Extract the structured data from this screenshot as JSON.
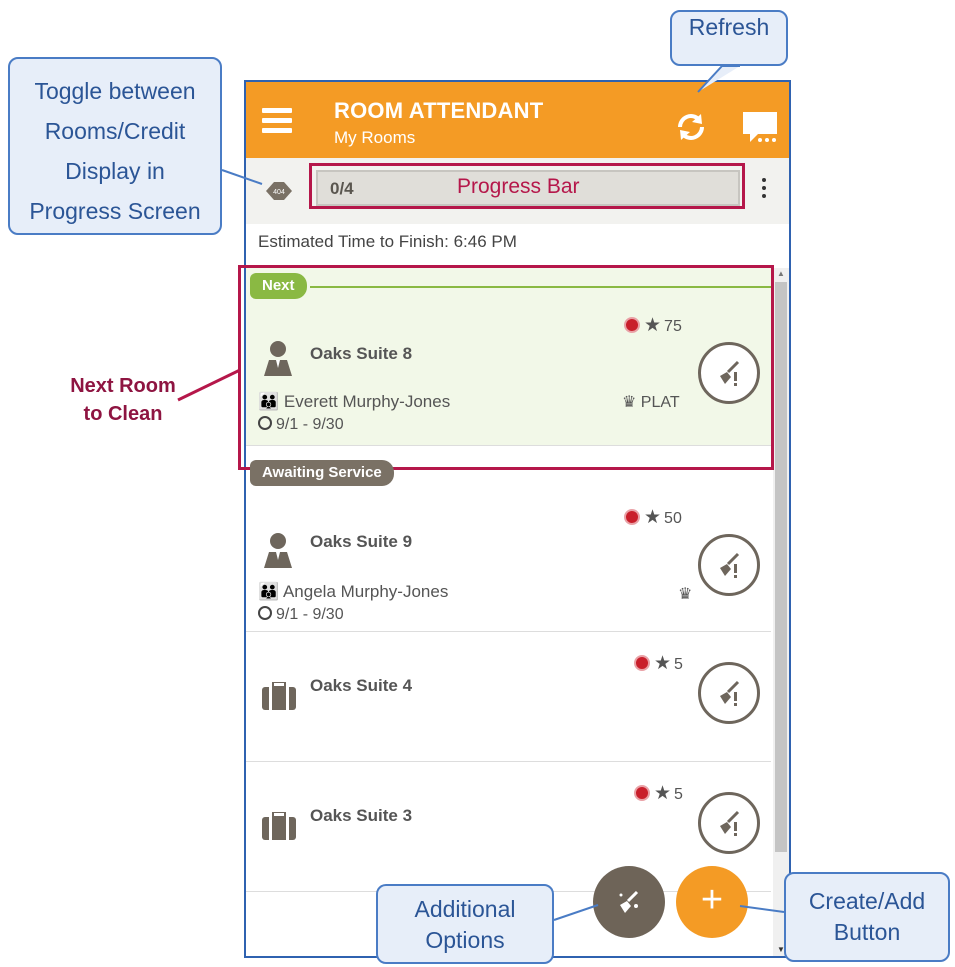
{
  "header": {
    "title": "ROOM ATTENDANT",
    "subtitle": "My Rooms"
  },
  "progress": {
    "toggle_label": "404",
    "count": "0/4",
    "bar_label": "Progress Bar"
  },
  "eta": "Estimated Time to Finish: 6:46 PM",
  "sections": {
    "next": "Next",
    "awaiting": "Awaiting Service"
  },
  "rooms": [
    {
      "name": "Oaks Suite 8",
      "guest": "Everett Murphy-Jones",
      "dates": "9/1 - 9/30",
      "points": "75",
      "vip": "PLAT",
      "type": "person-icon"
    },
    {
      "name": "Oaks Suite 9",
      "guest": "Angela Murphy-Jones",
      "dates": "9/1 - 9/30",
      "points": "50",
      "vip": "",
      "type": "person-icon"
    },
    {
      "name": "Oaks Suite 4",
      "points": "5",
      "type": "luggage-icon"
    },
    {
      "name": "Oaks Suite 3",
      "points": "5",
      "type": "luggage-icon"
    }
  ],
  "fab": {
    "add_label": "+"
  },
  "callouts": {
    "refresh": "Refresh",
    "toggle": [
      "Toggle between",
      "Rooms/Credit",
      "Display in",
      "Progress Screen"
    ],
    "additional": [
      "Additional",
      "Options"
    ],
    "create": [
      "Create/Add",
      "Button"
    ]
  },
  "annotation": [
    "Next Room",
    "to Clean"
  ],
  "colors": {
    "header": "#f49b25",
    "next_tag": "#8ab943",
    "awaiting_tag": "#7a7165",
    "highlight": "#b5174a",
    "callout_border": "#4a7cc5"
  }
}
